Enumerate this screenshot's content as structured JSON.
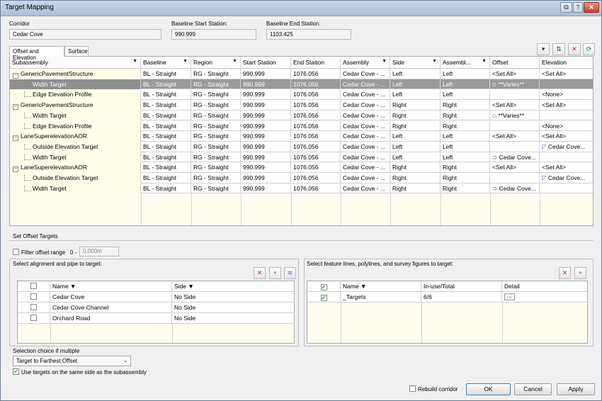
{
  "window": {
    "title": "Target Mapping",
    "btn_restore": "⧉",
    "btn_help": "?",
    "btn_close": "✕"
  },
  "corridor": {
    "label": "Corridor",
    "value": "Cedar Cove"
  },
  "start_station": {
    "label": "Baseline Start Station:",
    "value": "990.999"
  },
  "end_station": {
    "label": "Baseline End Station:",
    "value": "1103.425"
  },
  "tabs": [
    "Offset and Elevation",
    "Surface"
  ],
  "grid": {
    "headers": [
      "Subassembly",
      "Baseline",
      "Region",
      "Start Station",
      "End Station",
      "Assembly",
      "Side",
      "Assembl...",
      "Offset",
      "Elevation"
    ],
    "rows": [
      {
        "sub": "GenericPavementStructure",
        "level": 0,
        "baseline": "BL - Straight",
        "region": "RG - Straight",
        "start": "990.999",
        "end": "1076.056",
        "assembly": "Cedar Cove - ...",
        "side": "Left",
        "asside": "Left",
        "offset": "<Set All>",
        "elev": "<Set All>"
      },
      {
        "sub": "Width Target",
        "level": 1,
        "baseline": "BL - Straight",
        "region": "RG - Straight",
        "start": "990.999",
        "end": "1076.056",
        "assembly": "Cedar Cove - ...",
        "side": "Left",
        "asside": "Left",
        "offset": "**Varies**",
        "elev": "",
        "selected": true
      },
      {
        "sub": "Edge Elevation Profile",
        "level": 1,
        "baseline": "BL - Straight",
        "region": "RG - Straight",
        "start": "990.999",
        "end": "1076.056",
        "assembly": "Cedar Cove - ...",
        "side": "Left",
        "asside": "Left",
        "offset": "",
        "elev": "<None>"
      },
      {
        "sub": "GenericPavementStructure",
        "level": 0,
        "baseline": "BL - Straight",
        "region": "RG - Straight",
        "start": "990.999",
        "end": "1076.056",
        "assembly": "Cedar Cove - ...",
        "side": "Right",
        "asside": "Right",
        "offset": "<Set All>",
        "elev": "<Set All>"
      },
      {
        "sub": "Width Target",
        "level": 1,
        "baseline": "BL - Straight",
        "region": "RG - Straight",
        "start": "990.999",
        "end": "1076.056",
        "assembly": "Cedar Cove - ...",
        "side": "Right",
        "asside": "Right",
        "offset": "**Varies**",
        "elev": ""
      },
      {
        "sub": "Edge Elevation Profile",
        "level": 1,
        "baseline": "BL - Straight",
        "region": "RG - Straight",
        "start": "990.999",
        "end": "1076.056",
        "assembly": "Cedar Cove - ...",
        "side": "Right",
        "asside": "Right",
        "offset": "",
        "elev": "<None>"
      },
      {
        "sub": "LaneSuperelevationAOR",
        "level": 0,
        "baseline": "BL - Straight",
        "region": "RG - Straight",
        "start": "990.999",
        "end": "1076.056",
        "assembly": "Cedar Cove - ...",
        "side": "Left",
        "asside": "Left",
        "offset": "<Set All>",
        "elev": "<Set All>"
      },
      {
        "sub": "Outside Elevation Target",
        "level": 1,
        "baseline": "BL - Straight",
        "region": "RG - Straight",
        "start": "990.999",
        "end": "1076.056",
        "assembly": "Cedar Cove - ...",
        "side": "Left",
        "asside": "Left",
        "offset": "",
        "elev": "Cedar Cove..."
      },
      {
        "sub": "Width Target",
        "level": 1,
        "baseline": "BL - Straight",
        "region": "RG - Straight",
        "start": "990.999",
        "end": "1076.056",
        "assembly": "Cedar Cove - ...",
        "side": "Left",
        "asside": "Left",
        "offset": "Cedar Cove...",
        "elev": ""
      },
      {
        "sub": "LaneSuperelevationAOR",
        "level": 0,
        "baseline": "BL - Straight",
        "region": "RG - Straight",
        "start": "990.999",
        "end": "1076.056",
        "assembly": "Cedar Cove - ...",
        "side": "Right",
        "asside": "Right",
        "offset": "<Set All>",
        "elev": "<Set All>"
      },
      {
        "sub": "Outside Elevation Target",
        "level": 1,
        "baseline": "BL - Straight",
        "region": "RG - Straight",
        "start": "990.999",
        "end": "1076.056",
        "assembly": "Cedar Cove - ...",
        "side": "Right",
        "asside": "Right",
        "offset": "",
        "elev": "Cedar Cove..."
      },
      {
        "sub": "Width Target",
        "level": 1,
        "baseline": "BL - Straight",
        "region": "RG - Straight",
        "start": "990.999",
        "end": "1076.056",
        "assembly": "Cedar Cove - ...",
        "side": "Right",
        "asside": "Right",
        "offset": "Cedar Cove...",
        "elev": ""
      }
    ]
  },
  "set_offset": {
    "title": "Set Offset Targets",
    "filter_label": "Filter offset range",
    "range_from": "0 -",
    "range_to": "0.000m"
  },
  "left_panel": {
    "title": "Select alignment and pipe to target:",
    "headers": [
      "Name",
      "Side"
    ],
    "rows": [
      {
        "name": "Cedar Cove",
        "side": "No Side"
      },
      {
        "name": "Cedar Cove Channel",
        "side": "No Side"
      },
      {
        "name": "Orchard Road",
        "side": "No Side"
      }
    ]
  },
  "right_panel": {
    "title": "Select feature lines, polylines, and survey figures to target:",
    "headers": [
      "Name",
      "In-use/Total",
      "Detail"
    ],
    "rows": [
      {
        "name": "_Targets",
        "inuse": "6/6",
        "detail": "···"
      }
    ]
  },
  "selection": {
    "label": "Selection choice if multiple",
    "value": "Target to Farthest Offset",
    "same_side_label": "Use targets on the same side as the subassembly"
  },
  "footer": {
    "rebuild": "Rebuild corridor",
    "ok": "OK",
    "cancel": "Cancel",
    "apply": "Apply"
  },
  "colors": {
    "tree_bg": "#fffde8",
    "selected_row": "#9a9a9a",
    "title_bar": "#b9cde3"
  }
}
